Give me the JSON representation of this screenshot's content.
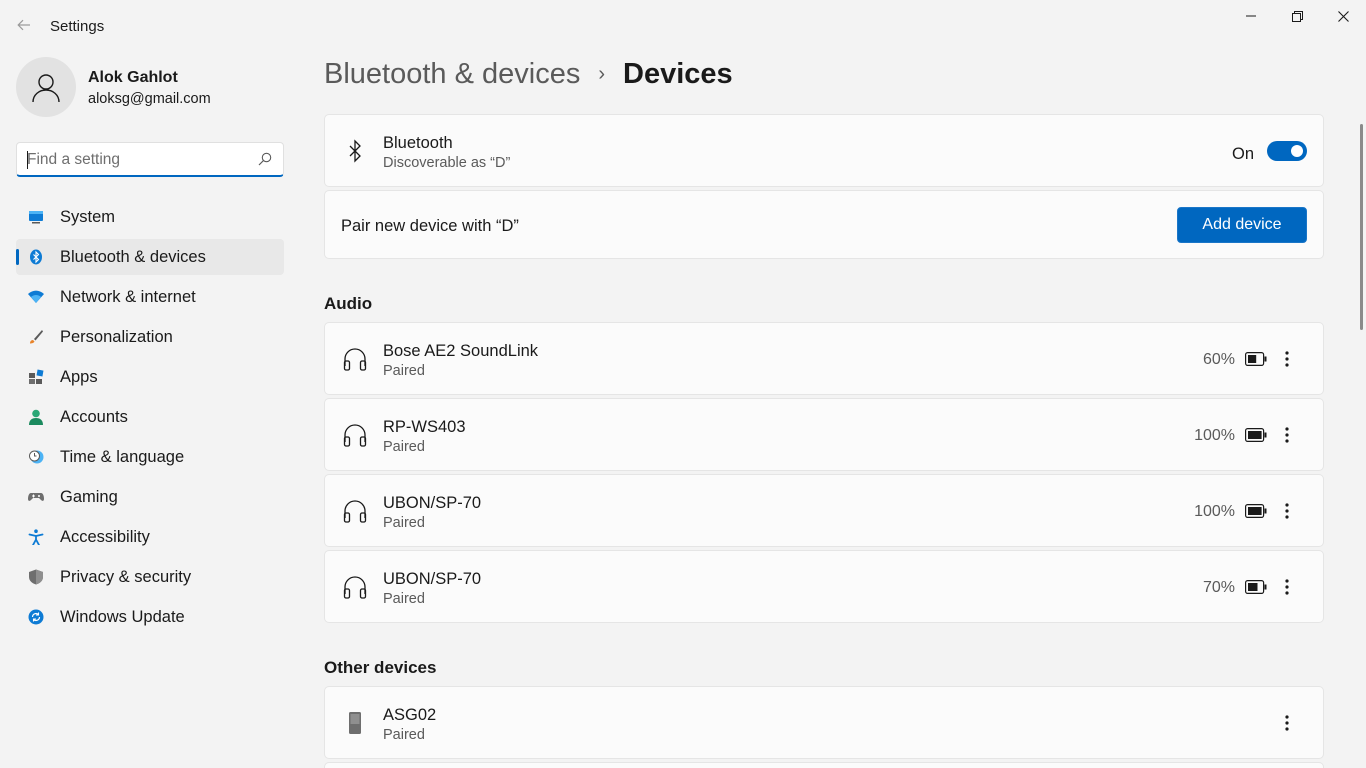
{
  "window": {
    "title": "Settings"
  },
  "profile": {
    "name": "Alok Gahlot",
    "email": "aloksg@gmail.com"
  },
  "search": {
    "placeholder": "Find a setting"
  },
  "nav": {
    "items": [
      {
        "label": "System",
        "icon": "system-icon",
        "active": false
      },
      {
        "label": "Bluetooth & devices",
        "icon": "bluetooth-icon",
        "active": true
      },
      {
        "label": "Network & internet",
        "icon": "wifi-icon",
        "active": false
      },
      {
        "label": "Personalization",
        "icon": "brush-icon",
        "active": false
      },
      {
        "label": "Apps",
        "icon": "apps-icon",
        "active": false
      },
      {
        "label": "Accounts",
        "icon": "accounts-icon",
        "active": false
      },
      {
        "label": "Time & language",
        "icon": "time-language-icon",
        "active": false
      },
      {
        "label": "Gaming",
        "icon": "gamepad-icon",
        "active": false
      },
      {
        "label": "Accessibility",
        "icon": "accessibility-icon",
        "active": false
      },
      {
        "label": "Privacy & security",
        "icon": "shield-icon",
        "active": false
      },
      {
        "label": "Windows Update",
        "icon": "update-icon",
        "active": false
      }
    ]
  },
  "breadcrumb": {
    "parent": "Bluetooth & devices",
    "separator": "›",
    "current": "Devices"
  },
  "bluetooth": {
    "title": "Bluetooth",
    "subtitle": "Discoverable as “D”",
    "state": "On",
    "enabled": true
  },
  "pair": {
    "label": "Pair new device with “D”",
    "button": "Add device"
  },
  "audio": {
    "title": "Audio",
    "devices": [
      {
        "name": "Bose AE2 SoundLink",
        "status": "Paired",
        "battery": "60%",
        "level": 0.6
      },
      {
        "name": "RP-WS403",
        "status": "Paired",
        "battery": "100%",
        "level": 1.0
      },
      {
        "name": "UBON/SP-70",
        "status": "Paired",
        "battery": "100%",
        "level": 1.0
      },
      {
        "name": "UBON/SP-70",
        "status": "Paired",
        "battery": "70%",
        "level": 0.7
      }
    ]
  },
  "other": {
    "title": "Other devices",
    "devices": [
      {
        "name": "ASG02",
        "status": "Paired"
      }
    ]
  },
  "colors": {
    "accent": "#0067c0",
    "background": "#f3f3f3",
    "card": "#fbfbfb"
  }
}
